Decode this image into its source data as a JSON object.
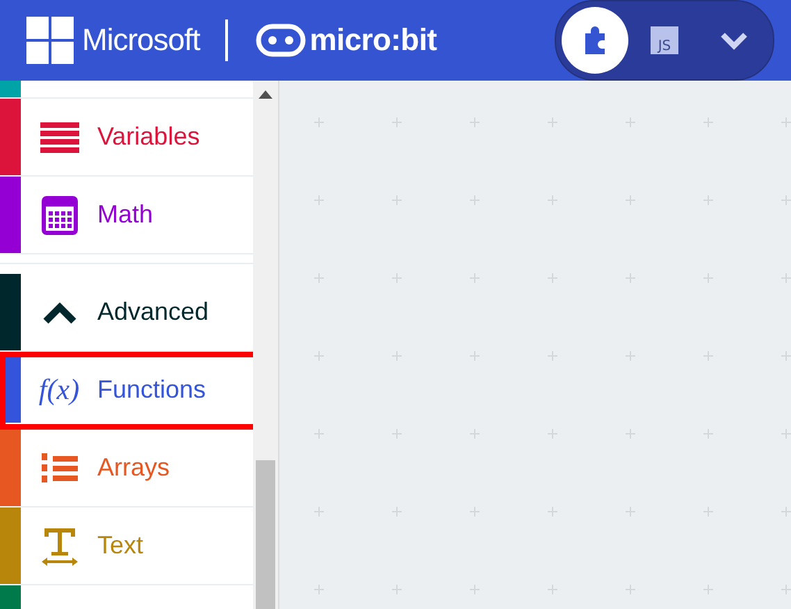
{
  "header": {
    "brand": "Microsoft",
    "product": "micro:bit",
    "editor_toggle": [
      {
        "kind": "blocks",
        "selected": true
      },
      {
        "kind": "javascript",
        "label": "JS",
        "selected": false
      },
      {
        "kind": "dropdown",
        "selected": false
      }
    ]
  },
  "toolbox": {
    "categories": [
      {
        "kind": "partial",
        "color": "#00a4a6"
      },
      {
        "kind": "category",
        "label": "Variables",
        "color": "#dc143c",
        "highlighted": false
      },
      {
        "kind": "category",
        "label": "Math",
        "color": "#9400d3",
        "highlighted": false
      },
      {
        "kind": "separator"
      },
      {
        "kind": "category",
        "label": "Advanced",
        "color": "#00272b",
        "highlighted": false
      },
      {
        "kind": "category",
        "icon_text": "f(x)",
        "label": "Functions",
        "color": "#3455db",
        "highlighted": true
      },
      {
        "kind": "category",
        "label": "Arrays",
        "color": "#e65722",
        "highlighted": false
      },
      {
        "kind": "category",
        "label": "Text",
        "color": "#b8860b",
        "highlighted": false
      },
      {
        "kind": "partial",
        "color": "#007a4b"
      }
    ]
  }
}
